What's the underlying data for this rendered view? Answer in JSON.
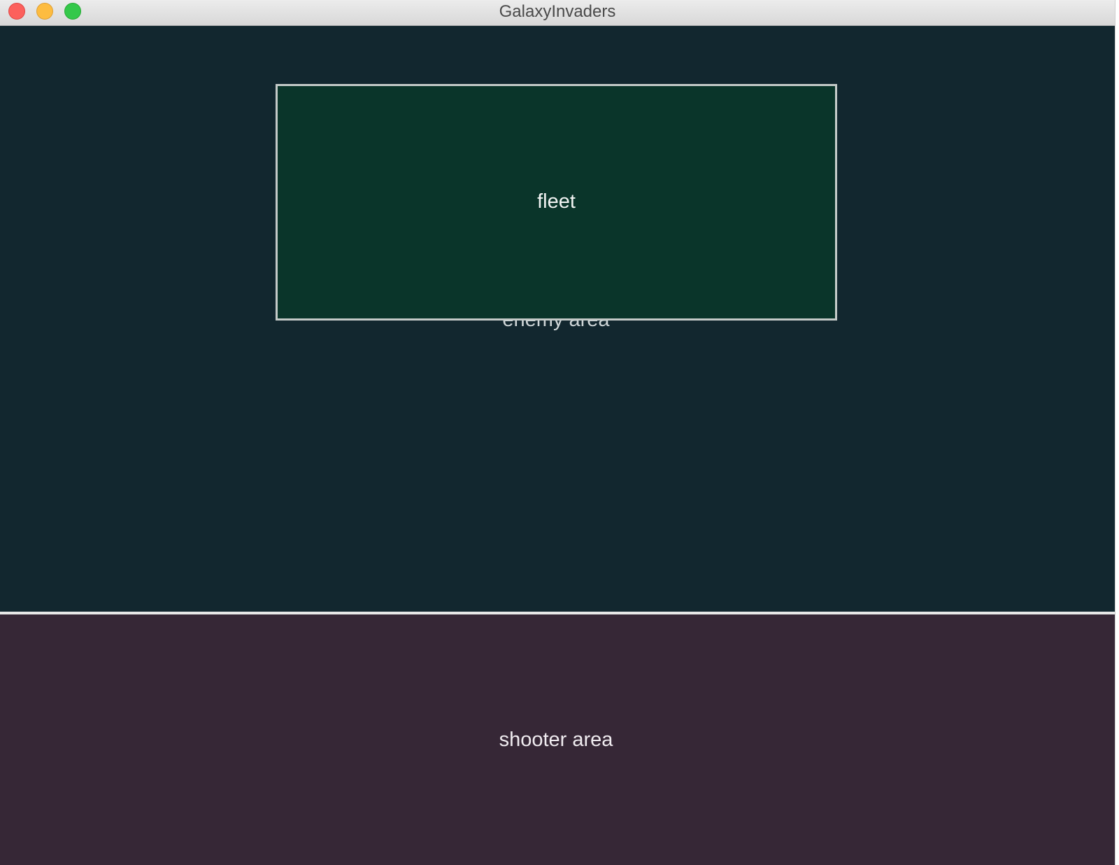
{
  "window": {
    "title": "GalaxyInvaders"
  },
  "game": {
    "fleet_label": "fleet",
    "enemy_area_label": "enemy area",
    "shooter_area_label": "shooter area"
  },
  "colors": {
    "enemy_area_bg": "#12272f",
    "fleet_bg": "#0a352a",
    "fleet_border": "#c4cac8",
    "shooter_area_bg": "#362736",
    "divider": "#e8e8e8"
  }
}
